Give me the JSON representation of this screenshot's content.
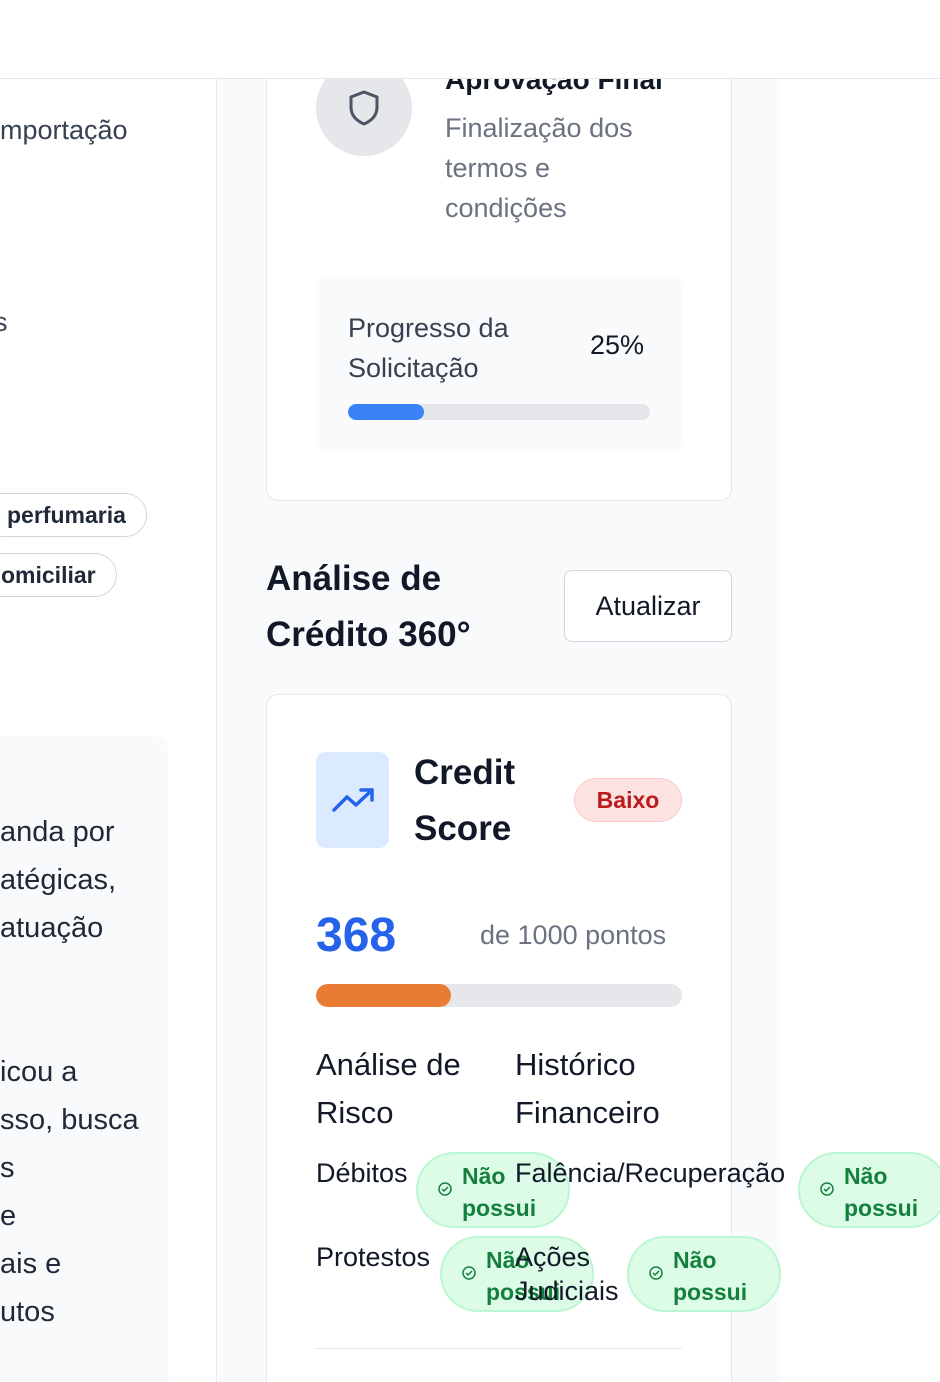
{
  "header": {
    "notifications_icon": "bell-icon"
  },
  "left_panel": {
    "importacao_fragment": "mportação",
    "s_fragment": "s",
    "tags": [
      "perfumaria",
      "omiciliar"
    ],
    "description_lines_1": [
      "anda por",
      "atégicas,",
      "atuação"
    ],
    "description_lines_2": [
      "icou a",
      "sso, busca",
      "s",
      "e",
      "ais e",
      "utos"
    ]
  },
  "approval_step": {
    "icon": "shield-icon",
    "title": "Aprovação Final",
    "description": "Finalização dos termos e condições"
  },
  "request_progress": {
    "label": "Progresso da Solicitação",
    "percent_label": "25%",
    "percent": 0.25,
    "fill_color": "#3b82f6"
  },
  "credit_analysis": {
    "title": "Análise de Crédito 360°",
    "refresh_label": "Atualizar"
  },
  "credit_score": {
    "icon": "trending-up-icon",
    "title": "Credit Score",
    "risk_badge": "Baixo",
    "value": "368",
    "max_label": "de 1000 pontos",
    "fraction": 0.368,
    "bar_color": "#e97c35",
    "risk_column": {
      "title": "Análise de Risco",
      "items": [
        {
          "label": "Débitos",
          "status": "Não possui"
        },
        {
          "label": "Protestos",
          "status": "Não possui"
        }
      ]
    },
    "financial_column": {
      "title": "Histórico Financeiro",
      "items": [
        {
          "label": "Falência/Recuperação",
          "status": "Não possui"
        },
        {
          "label": "Ações Judiciais",
          "status": "Não possui"
        }
      ]
    }
  }
}
